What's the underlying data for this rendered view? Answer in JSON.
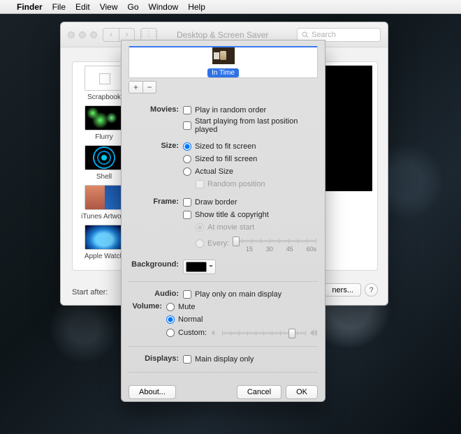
{
  "menubar": {
    "app": "Finder",
    "items": [
      "File",
      "Edit",
      "View",
      "Go",
      "Window",
      "Help"
    ]
  },
  "syspref": {
    "title": "Desktop & Screen Saver",
    "search_placeholder": "Search",
    "screensavers": [
      {
        "label": "Scrapbook",
        "thumb": "scrap"
      },
      {
        "label": "Flurry",
        "thumb": "flurry"
      },
      {
        "label": "Shell",
        "thumb": "shell"
      },
      {
        "label": "iTunes Artwork",
        "thumb": "itunes"
      },
      {
        "label": "Apple Watch",
        "thumb": "watch"
      }
    ],
    "start_after_label": "Start after:",
    "corners_label": "ners...",
    "help_label": "?"
  },
  "sheet": {
    "movie_name": "In Time",
    "add": "+",
    "remove": "−",
    "sections": {
      "movies": {
        "label": "Movies:",
        "random": "Play in random order",
        "resume": "Start playing from last position played"
      },
      "size": {
        "label": "Size:",
        "fit": "Sized to fit screen",
        "fill": "Sized to fill screen",
        "actual": "Actual Size",
        "random_pos": "Random position"
      },
      "frame": {
        "label": "Frame:",
        "border": "Draw border",
        "title": "Show title & copyright",
        "at_start": "At movie start",
        "every": "Every:",
        "ticks": [
          "15",
          "30",
          "45",
          "60s"
        ]
      },
      "background": {
        "label": "Background:"
      },
      "audio": {
        "label": "Audio:",
        "main_only": "Play only on main display"
      },
      "volume": {
        "label": "Volume:",
        "mute": "Mute",
        "normal": "Normal",
        "custom": "Custom:"
      },
      "displays": {
        "label": "Displays:",
        "main_only": "Main display only"
      }
    },
    "buttons": {
      "about": "About...",
      "cancel": "Cancel",
      "ok": "OK"
    }
  }
}
